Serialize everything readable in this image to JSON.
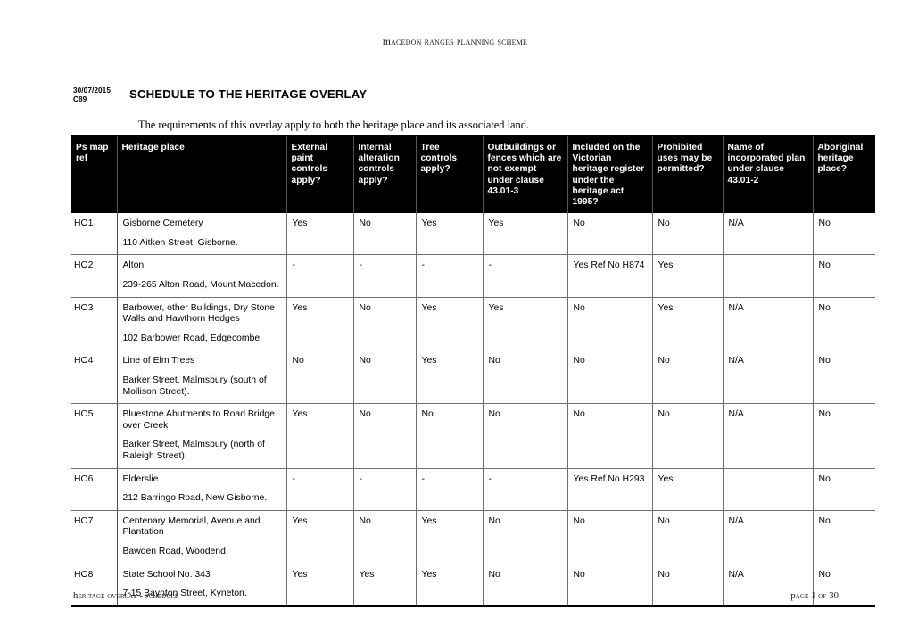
{
  "document": {
    "running_header": "Macedon Ranges Planning Scheme",
    "amendment_date": "30/07/2015",
    "amendment_ref": "C89",
    "title": "SCHEDULE TO THE HERITAGE OVERLAY",
    "intro": "The requirements of this overlay apply to both the heritage place and its associated land.",
    "footer_left": "Heritage Overlay - Schedule",
    "footer_right": "Page 1 of 30"
  },
  "table": {
    "columns": [
      "Ps map ref",
      "Heritage place",
      "External paint controls apply?",
      "Internal alteration controls apply?",
      "Tree controls apply?",
      "Outbuildings or fences which are not exempt under clause 43.01-3",
      "Included on the Victorian heritage register under the heritage act 1995?",
      "Prohibited uses may be permitted?",
      "Name of incorporated plan under clause 43.01-2",
      "Aboriginal heritage place?"
    ],
    "rows": [
      {
        "ref": "HO1",
        "place_name": "Gisborne Cemetery",
        "place_address": "110 Aitken Street, Gisborne.",
        "external_paint": "Yes",
        "internal_alteration": "No",
        "tree_controls": "Yes",
        "outbuildings_fences": "Yes",
        "vic_heritage_register": "No",
        "prohibited_uses": "No",
        "incorporated_plan": "N/A",
        "aboriginal_heritage": "No"
      },
      {
        "ref": "HO2",
        "place_name": "Alton",
        "place_address": "239-265 Alton Road, Mount Macedon.",
        "external_paint": "-",
        "internal_alteration": "-",
        "tree_controls": "-",
        "outbuildings_fences": "-",
        "vic_heritage_register": "Yes Ref No H874",
        "prohibited_uses": "Yes",
        "incorporated_plan": "",
        "aboriginal_heritage": "No"
      },
      {
        "ref": "HO3",
        "place_name": "Barbower, other Buildings, Dry Stone Walls and Hawthorn Hedges",
        "place_address": "102 Barbower Road, Edgecombe.",
        "external_paint": "Yes",
        "internal_alteration": "No",
        "tree_controls": "Yes",
        "outbuildings_fences": "Yes",
        "vic_heritage_register": "No",
        "prohibited_uses": "Yes",
        "incorporated_plan": "N/A",
        "aboriginal_heritage": "No"
      },
      {
        "ref": "HO4",
        "place_name": "Line of Elm Trees",
        "place_address": "Barker Street, Malmsbury (south of Mollison Street).",
        "external_paint": "No",
        "internal_alteration": "No",
        "tree_controls": "Yes",
        "outbuildings_fences": "No",
        "vic_heritage_register": "No",
        "prohibited_uses": "No",
        "incorporated_plan": "N/A",
        "aboriginal_heritage": "No"
      },
      {
        "ref": "HO5",
        "place_name": "Bluestone Abutments to Road Bridge over Creek",
        "place_address": "Barker Street, Malmsbury (north of Raleigh Street).",
        "external_paint": "Yes",
        "internal_alteration": "No",
        "tree_controls": "No",
        "outbuildings_fences": "No",
        "vic_heritage_register": "No",
        "prohibited_uses": "No",
        "incorporated_plan": "N/A",
        "aboriginal_heritage": "No"
      },
      {
        "ref": "HO6",
        "place_name": "Elderslie",
        "place_address": "212 Barringo Road, New Gisborne.",
        "external_paint": "-",
        "internal_alteration": "-",
        "tree_controls": "-",
        "outbuildings_fences": "-",
        "vic_heritage_register": "Yes Ref No H293",
        "prohibited_uses": "Yes",
        "incorporated_plan": "",
        "aboriginal_heritage": "No"
      },
      {
        "ref": "HO7",
        "place_name": "Centenary Memorial, Avenue and Plantation",
        "place_address": "Bawden Road, Woodend.",
        "external_paint": "Yes",
        "internal_alteration": "No",
        "tree_controls": "Yes",
        "outbuildings_fences": "No",
        "vic_heritage_register": "No",
        "prohibited_uses": "No",
        "incorporated_plan": "N/A",
        "aboriginal_heritage": "No"
      },
      {
        "ref": "HO8",
        "place_name": "State School No. 343",
        "place_address": "7-15 Baynton Street, Kyneton.",
        "external_paint": "Yes",
        "internal_alteration": "Yes",
        "tree_controls": "Yes",
        "outbuildings_fences": "No",
        "vic_heritage_register": "No",
        "prohibited_uses": "No",
        "incorporated_plan": "N/A",
        "aboriginal_heritage": "No"
      }
    ]
  }
}
